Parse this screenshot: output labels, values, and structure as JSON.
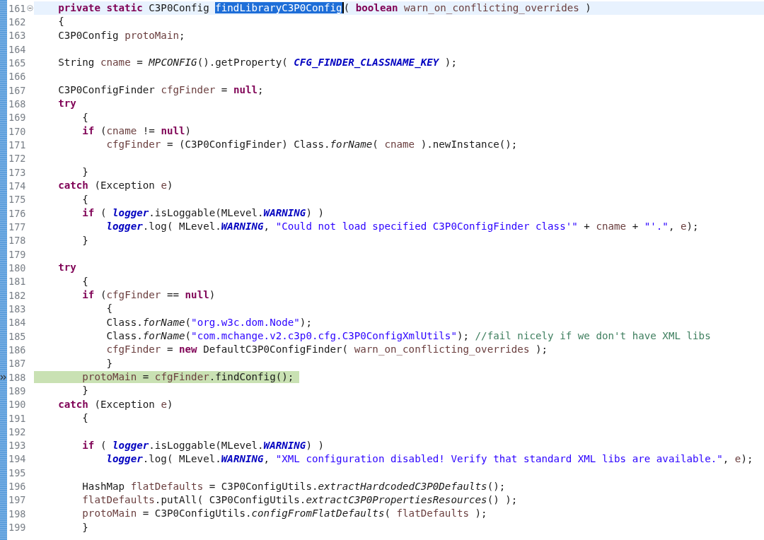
{
  "lines": [
    {
      "number": "161",
      "current": true,
      "paused": false,
      "fold_open": true,
      "tokens": [
        {
          "kind": "keyword",
          "text": "    private "
        },
        {
          "kind": "keyword",
          "text": "static"
        },
        {
          "kind": "plain",
          "text": " C3P0Config "
        },
        {
          "kind": "selection",
          "text": "findLibraryC3P0Config"
        },
        {
          "kind": "plain",
          "text": "( "
        },
        {
          "kind": "keyword",
          "text": "boolean "
        },
        {
          "kind": "local",
          "text": "warn_on_conflicting_overrides"
        },
        {
          "kind": "plain",
          "text": " )"
        }
      ]
    },
    {
      "number": "162",
      "current": false,
      "paused": false,
      "fold_open": false,
      "tokens": [
        {
          "kind": "plain",
          "text": "    {"
        }
      ]
    },
    {
      "number": "163",
      "current": false,
      "paused": false,
      "fold_open": false,
      "tokens": [
        {
          "kind": "plain",
          "text": "    C3P0Config "
        },
        {
          "kind": "local",
          "text": "protoMain"
        },
        {
          "kind": "plain",
          "text": ";"
        }
      ]
    },
    {
      "number": "164",
      "current": false,
      "paused": false,
      "fold_open": false
    },
    {
      "number": "165",
      "current": false,
      "paused": false,
      "fold_open": false,
      "tokens": [
        {
          "kind": "plain",
          "text": "    String "
        },
        {
          "kind": "local",
          "text": "cname"
        },
        {
          "kind": "plain",
          "text": " = "
        },
        {
          "kind": "static",
          "text": "MPCONFIG"
        },
        {
          "kind": "plain",
          "text": "().getProperty( "
        },
        {
          "kind": "constant",
          "text": "CFG_FINDER_CLASSNAME_KEY"
        },
        {
          "kind": "plain",
          "text": " );"
        }
      ]
    },
    {
      "number": "166",
      "current": false,
      "paused": false,
      "fold_open": false
    },
    {
      "number": "167",
      "current": false,
      "paused": false,
      "fold_open": false,
      "tokens": [
        {
          "kind": "plain",
          "text": "    C3P0ConfigFinder "
        },
        {
          "kind": "local",
          "text": "cfgFinder"
        },
        {
          "kind": "plain",
          "text": " = "
        },
        {
          "kind": "keyword",
          "text": "null"
        },
        {
          "kind": "plain",
          "text": ";"
        }
      ]
    },
    {
      "number": "168",
      "current": false,
      "paused": false,
      "fold_open": false,
      "tokens": [
        {
          "kind": "keyword",
          "text": "    try"
        }
      ]
    },
    {
      "number": "169",
      "current": false,
      "paused": false,
      "fold_open": false,
      "tokens": [
        {
          "kind": "plain",
          "text": "        {"
        }
      ]
    },
    {
      "number": "170",
      "current": false,
      "paused": false,
      "fold_open": false,
      "tokens": [
        {
          "kind": "keyword",
          "text": "        if"
        },
        {
          "kind": "plain",
          "text": " ("
        },
        {
          "kind": "local",
          "text": "cname"
        },
        {
          "kind": "plain",
          "text": " != "
        },
        {
          "kind": "keyword",
          "text": "null"
        },
        {
          "kind": "plain",
          "text": ")"
        }
      ]
    },
    {
      "number": "171",
      "current": false,
      "paused": false,
      "fold_open": false,
      "tokens": [
        {
          "kind": "local",
          "text": "            cfgFinder"
        },
        {
          "kind": "plain",
          "text": " = (C3P0ConfigFinder) Class."
        },
        {
          "kind": "static",
          "text": "forName"
        },
        {
          "kind": "plain",
          "text": "( "
        },
        {
          "kind": "local",
          "text": "cname"
        },
        {
          "kind": "plain",
          "text": " ).newInstance();"
        }
      ]
    },
    {
      "number": "172",
      "current": false,
      "paused": false,
      "fold_open": false
    },
    {
      "number": "173",
      "current": false,
      "paused": false,
      "fold_open": false,
      "tokens": [
        {
          "kind": "plain",
          "text": "        }"
        }
      ]
    },
    {
      "number": "174",
      "current": false,
      "paused": false,
      "fold_open": false,
      "tokens": [
        {
          "kind": "keyword",
          "text": "    catch"
        },
        {
          "kind": "plain",
          "text": " (Exception "
        },
        {
          "kind": "local",
          "text": "e"
        },
        {
          "kind": "plain",
          "text": ")"
        }
      ]
    },
    {
      "number": "175",
      "current": false,
      "paused": false,
      "fold_open": false,
      "tokens": [
        {
          "kind": "plain",
          "text": "        {"
        }
      ]
    },
    {
      "number": "176",
      "current": false,
      "paused": false,
      "fold_open": false,
      "tokens": [
        {
          "kind": "keyword",
          "text": "        if"
        },
        {
          "kind": "plain",
          "text": " ( "
        },
        {
          "kind": "constant",
          "text": "logger"
        },
        {
          "kind": "plain",
          "text": ".isLoggable(MLevel."
        },
        {
          "kind": "constant",
          "text": "WARNING"
        },
        {
          "kind": "plain",
          "text": ") )"
        }
      ]
    },
    {
      "number": "177",
      "current": false,
      "paused": false,
      "fold_open": false,
      "tokens": [
        {
          "kind": "constant",
          "text": "            logger"
        },
        {
          "kind": "plain",
          "text": ".log( MLevel."
        },
        {
          "kind": "constant",
          "text": "WARNING"
        },
        {
          "kind": "plain",
          "text": ", "
        },
        {
          "kind": "string",
          "text": "\"Could not load specified C3P0ConfigFinder class'\""
        },
        {
          "kind": "plain",
          "text": " + "
        },
        {
          "kind": "local",
          "text": "cname"
        },
        {
          "kind": "plain",
          "text": " + "
        },
        {
          "kind": "string",
          "text": "\"'.\""
        },
        {
          "kind": "plain",
          "text": ", "
        },
        {
          "kind": "local",
          "text": "e"
        },
        {
          "kind": "plain",
          "text": ");"
        }
      ]
    },
    {
      "number": "178",
      "current": false,
      "paused": false,
      "fold_open": false,
      "tokens": [
        {
          "kind": "plain",
          "text": "        }"
        }
      ]
    },
    {
      "number": "179",
      "current": false,
      "paused": false,
      "fold_open": false
    },
    {
      "number": "180",
      "current": false,
      "paused": false,
      "fold_open": false,
      "tokens": [
        {
          "kind": "keyword",
          "text": "    try"
        }
      ]
    },
    {
      "number": "181",
      "current": false,
      "paused": false,
      "fold_open": false,
      "tokens": [
        {
          "kind": "plain",
          "text": "        {"
        }
      ]
    },
    {
      "number": "182",
      "current": false,
      "paused": false,
      "fold_open": false,
      "tokens": [
        {
          "kind": "keyword",
          "text": "        if"
        },
        {
          "kind": "plain",
          "text": " ("
        },
        {
          "kind": "local",
          "text": "cfgFinder"
        },
        {
          "kind": "plain",
          "text": " == "
        },
        {
          "kind": "keyword",
          "text": "null"
        },
        {
          "kind": "plain",
          "text": ")"
        }
      ]
    },
    {
      "number": "183",
      "current": false,
      "paused": false,
      "fold_open": false,
      "tokens": [
        {
          "kind": "plain",
          "text": "            {"
        }
      ]
    },
    {
      "number": "184",
      "current": false,
      "paused": false,
      "fold_open": false,
      "tokens": [
        {
          "kind": "plain",
          "text": "            Class."
        },
        {
          "kind": "static",
          "text": "forName"
        },
        {
          "kind": "plain",
          "text": "("
        },
        {
          "kind": "string",
          "text": "\"org.w3c.dom.Node\""
        },
        {
          "kind": "plain",
          "text": ");"
        }
      ]
    },
    {
      "number": "185",
      "current": false,
      "paused": false,
      "fold_open": false,
      "tokens": [
        {
          "kind": "plain",
          "text": "            Class."
        },
        {
          "kind": "static",
          "text": "forName"
        },
        {
          "kind": "plain",
          "text": "("
        },
        {
          "kind": "string",
          "text": "\"com.mchange.v2.c3p0.cfg.C3P0ConfigXmlUtils\""
        },
        {
          "kind": "plain",
          "text": "); "
        },
        {
          "kind": "comment",
          "text": "//fail nicely if we don't have XML libs"
        }
      ]
    },
    {
      "number": "186",
      "current": false,
      "paused": false,
      "fold_open": false,
      "tokens": [
        {
          "kind": "local",
          "text": "            cfgFinder"
        },
        {
          "kind": "plain",
          "text": " = "
        },
        {
          "kind": "keyword",
          "text": "new"
        },
        {
          "kind": "plain",
          "text": " DefaultC3P0ConfigFinder( "
        },
        {
          "kind": "local",
          "text": "warn_on_conflicting_overrides"
        },
        {
          "kind": "plain",
          "text": " );"
        }
      ]
    },
    {
      "number": "187",
      "current": false,
      "paused": false,
      "fold_open": false,
      "tokens": [
        {
          "kind": "plain",
          "text": "            }"
        }
      ]
    },
    {
      "number": "188",
      "current": false,
      "paused": true,
      "fold_open": false,
      "tokens": [
        {
          "kind": "local",
          "text": "        protoMain"
        },
        {
          "kind": "plain",
          "text": " = "
        },
        {
          "kind": "local",
          "text": "cfgFinder"
        },
        {
          "kind": "plain",
          "text": ".findConfig();"
        }
      ]
    },
    {
      "number": "189",
      "current": false,
      "paused": false,
      "fold_open": false,
      "tokens": [
        {
          "kind": "plain",
          "text": "        }"
        }
      ]
    },
    {
      "number": "190",
      "current": false,
      "paused": false,
      "fold_open": false,
      "tokens": [
        {
          "kind": "keyword",
          "text": "    catch"
        },
        {
          "kind": "plain",
          "text": " (Exception "
        },
        {
          "kind": "local",
          "text": "e"
        },
        {
          "kind": "plain",
          "text": ")"
        }
      ]
    },
    {
      "number": "191",
      "current": false,
      "paused": false,
      "fold_open": false,
      "tokens": [
        {
          "kind": "plain",
          "text": "        {"
        }
      ]
    },
    {
      "number": "192",
      "current": false,
      "paused": false,
      "fold_open": false
    },
    {
      "number": "193",
      "current": false,
      "paused": false,
      "fold_open": false,
      "tokens": [
        {
          "kind": "keyword",
          "text": "        if"
        },
        {
          "kind": "plain",
          "text": " ( "
        },
        {
          "kind": "constant",
          "text": "logger"
        },
        {
          "kind": "plain",
          "text": ".isLoggable(MLevel."
        },
        {
          "kind": "constant",
          "text": "WARNING"
        },
        {
          "kind": "plain",
          "text": ") )"
        }
      ]
    },
    {
      "number": "194",
      "current": false,
      "paused": false,
      "fold_open": false,
      "tokens": [
        {
          "kind": "constant",
          "text": "            logger"
        },
        {
          "kind": "plain",
          "text": ".log( MLevel."
        },
        {
          "kind": "constant",
          "text": "WARNING"
        },
        {
          "kind": "plain",
          "text": ", "
        },
        {
          "kind": "string",
          "text": "\"XML configuration disabled! Verify that standard XML libs are available.\""
        },
        {
          "kind": "plain",
          "text": ", "
        },
        {
          "kind": "local",
          "text": "e"
        },
        {
          "kind": "plain",
          "text": ");"
        }
      ]
    },
    {
      "number": "195",
      "current": false,
      "paused": false,
      "fold_open": false
    },
    {
      "number": "196",
      "current": false,
      "paused": false,
      "fold_open": false,
      "tokens": [
        {
          "kind": "plain",
          "text": "        HashMap "
        },
        {
          "kind": "local",
          "text": "flatDefaults"
        },
        {
          "kind": "plain",
          "text": " = C3P0ConfigUtils."
        },
        {
          "kind": "static",
          "text": "extractHardcodedC3P0Defaults"
        },
        {
          "kind": "plain",
          "text": "();"
        }
      ]
    },
    {
      "number": "197",
      "current": false,
      "paused": false,
      "fold_open": false,
      "tokens": [
        {
          "kind": "local",
          "text": "        flatDefaults"
        },
        {
          "kind": "plain",
          "text": ".putAll( C3P0ConfigUtils."
        },
        {
          "kind": "static",
          "text": "extractC3P0PropertiesResources"
        },
        {
          "kind": "plain",
          "text": "() );"
        }
      ]
    },
    {
      "number": "198",
      "current": false,
      "paused": false,
      "fold_open": false,
      "tokens": [
        {
          "kind": "local",
          "text": "        protoMain"
        },
        {
          "kind": "plain",
          "text": " = C3P0ConfigUtils."
        },
        {
          "kind": "static",
          "text": "configFromFlatDefaults"
        },
        {
          "kind": "plain",
          "text": "( "
        },
        {
          "kind": "local",
          "text": "flatDefaults"
        },
        {
          "kind": "plain",
          "text": " );"
        }
      ]
    },
    {
      "number": "199",
      "current": false,
      "paused": false,
      "fold_open": false,
      "tokens": [
        {
          "kind": "plain",
          "text": "        }"
        }
      ]
    }
  ]
}
